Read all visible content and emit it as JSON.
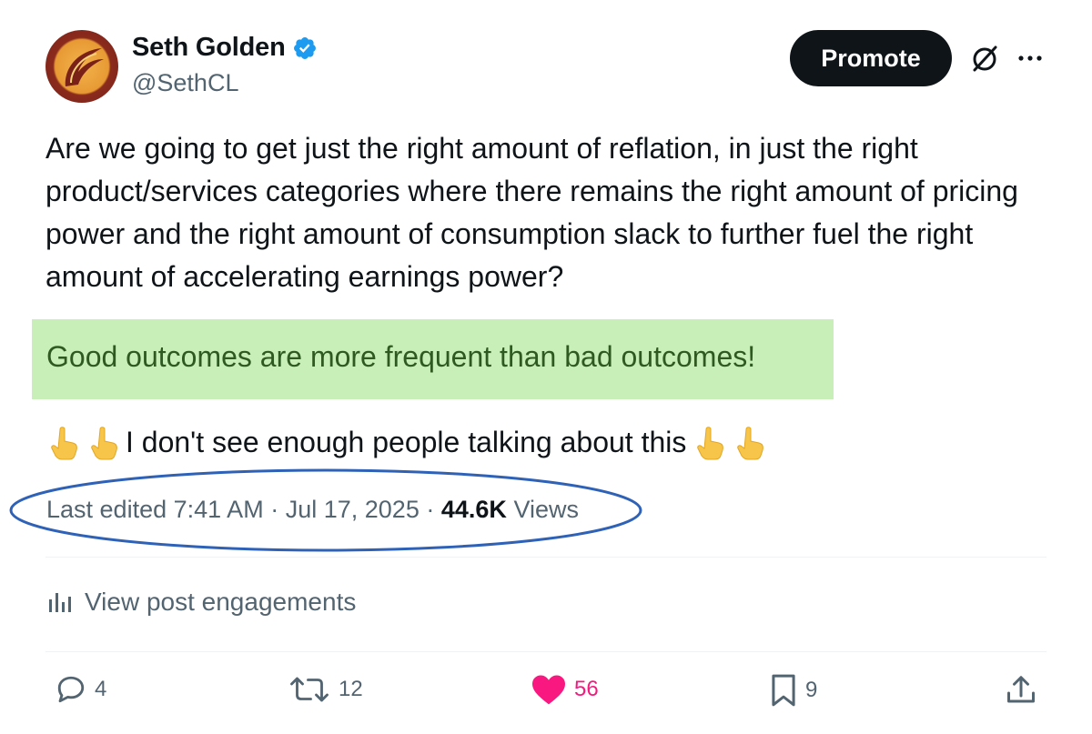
{
  "author": {
    "display_name": "Seth Golden",
    "handle": "@SethCL"
  },
  "header": {
    "promote_label": "Promote"
  },
  "post": {
    "body": "Are we going to get just the right amount of reflation, in just the right product/services categories where there remains the right amount of pricing power and the right amount of consumption slack to further fuel the right amount of accelerating earnings power?",
    "highlight": "Good outcomes are more frequent than bad outcomes!",
    "callout": "I don't see enough people talking about this"
  },
  "meta": {
    "edited_prefix": "Last edited",
    "time": "7:41 AM",
    "date": "Jul 17, 2025",
    "views_count": "44.6K",
    "views_label": "Views",
    "separator": "·"
  },
  "engagements": {
    "label": "View post engagements"
  },
  "actions": {
    "replies": "4",
    "reposts": "12",
    "likes": "56",
    "bookmarks": "9"
  },
  "colors": {
    "accent": "#1d9bf0",
    "like": "#f91880",
    "highlight_bg": "#c9efb8",
    "annotation_oval": "#2f62b7"
  },
  "icons": {
    "verified": "verified-badge-icon",
    "grok": "grok-icon",
    "more": "more-icon",
    "reply": "reply-icon",
    "repost": "repost-icon",
    "like": "heart-icon",
    "bookmark": "bookmark-icon",
    "share": "share-icon",
    "analytics": "analytics-icon",
    "emoji": "pointing-up-emoji"
  }
}
